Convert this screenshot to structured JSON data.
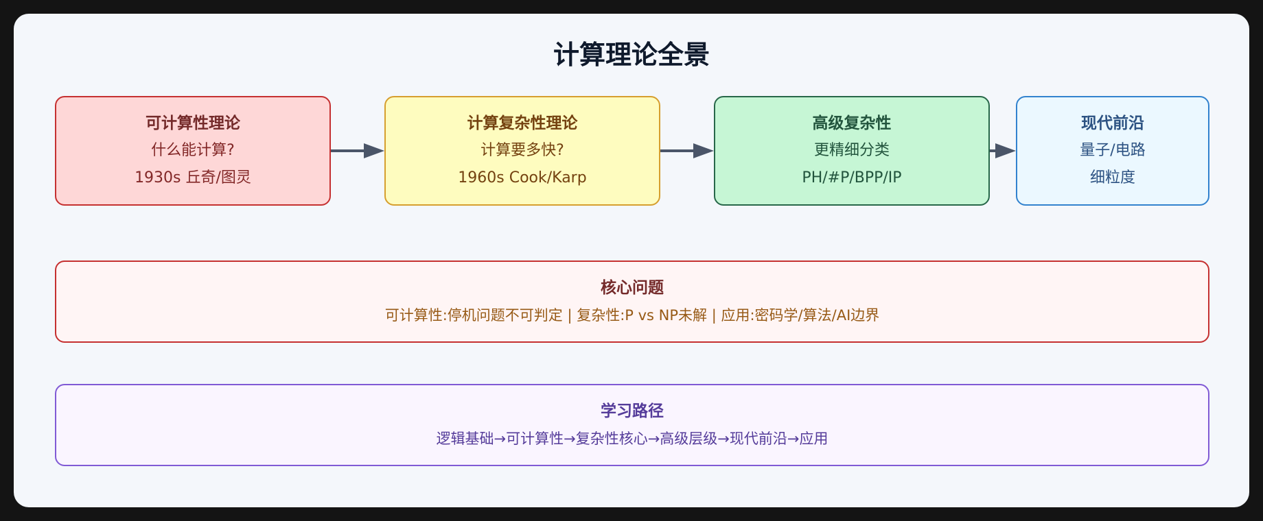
{
  "title": "计算理论全景",
  "stages": [
    {
      "title": "可计算性理论",
      "line1": "什么能计算?",
      "line2": "1930s 丘奇/图灵"
    },
    {
      "title": "计算复杂性理论",
      "line1": "计算要多快?",
      "line2": "1960s Cook/Karp"
    },
    {
      "title": "高级复杂性",
      "line1": "更精细分类",
      "line2": "PH/#P/BPP/IP"
    },
    {
      "title": "现代前沿",
      "line1": "量子/电路",
      "line2": "细粒度"
    }
  ],
  "core": {
    "title": "核心问题",
    "text": "可计算性:停机问题不可判定 | 复杂性:P vs NP未解 | 应用:密码学/算法/AI边界"
  },
  "path": {
    "title": "学习路径",
    "text": "逻辑基础→可计算性→复杂性核心→高级层级→现代前沿→应用"
  },
  "colors": {
    "stage1_bg": "#fed7d7",
    "stage1_border": "#c53030",
    "stage1_title": "#742a2a",
    "stage1_text": "#822727",
    "stage2_bg": "#fefcbf",
    "stage2_border": "#d69e2e",
    "stage2_title": "#744210",
    "stage2_text": "#744210",
    "stage3_bg": "#c6f6d5",
    "stage3_border": "#276749",
    "stage3_title": "#22543d",
    "stage3_text": "#22543d",
    "stage4_bg": "#ebf8ff",
    "stage4_border": "#3182ce",
    "stage4_title": "#2c5282",
    "stage4_text": "#2c5282",
    "core_bg": "#fff5f5",
    "core_border": "#c53030",
    "core_title": "#742a2a",
    "core_text": "#975a16",
    "path_bg": "#faf5ff",
    "path_border": "#805ad5",
    "path_title": "#553c9a",
    "path_text": "#553c9a",
    "arrow": "#4a5568"
  }
}
